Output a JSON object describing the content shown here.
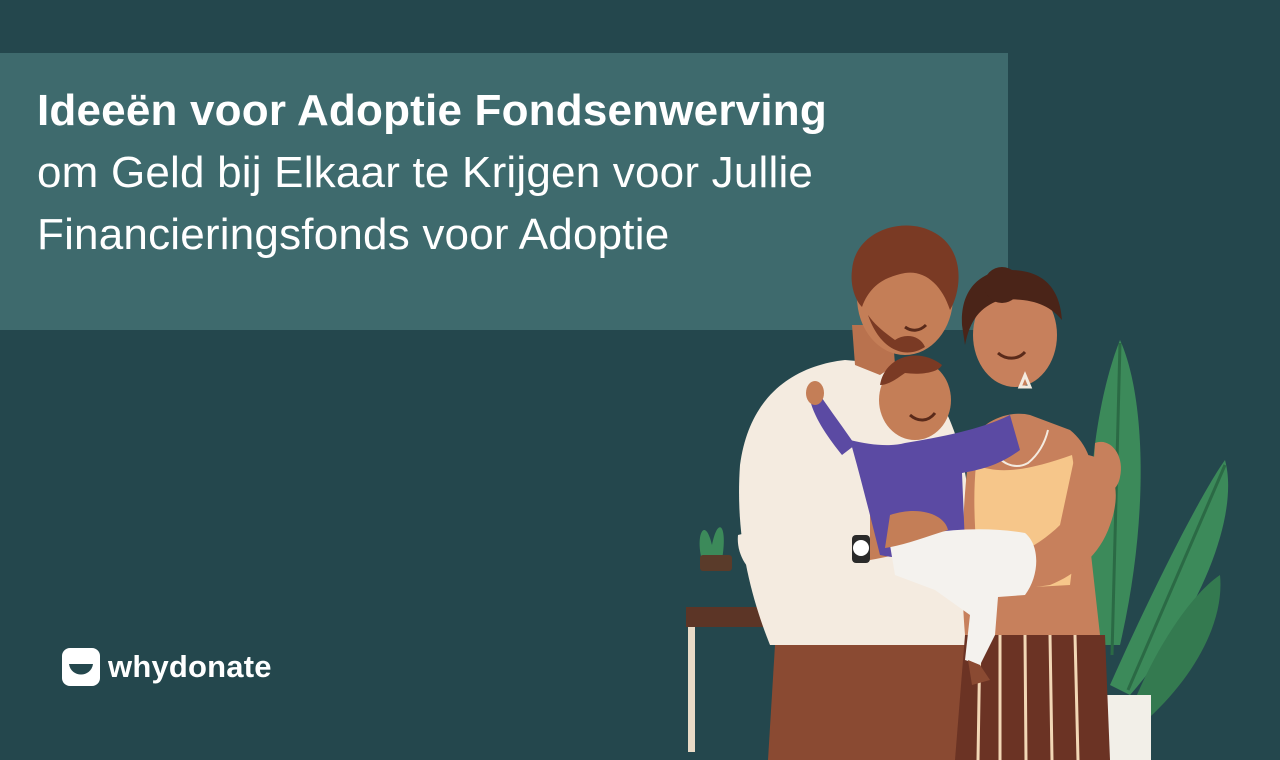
{
  "headline": {
    "line1": "Ideeën voor Adoptie Fondsenwerving",
    "line2": "om Geld bij Elkaar te Krijgen voor Jullie",
    "line3": "Financieringsfonds voor Adoptie"
  },
  "brand": {
    "name": "whydonate",
    "icon": "whydonate-logo-icon"
  },
  "illustration": {
    "icon": "family-adoption-illustration"
  },
  "colors": {
    "background": "#24474d",
    "title_panel": "#3e6a6d",
    "text": "#ffffff"
  }
}
